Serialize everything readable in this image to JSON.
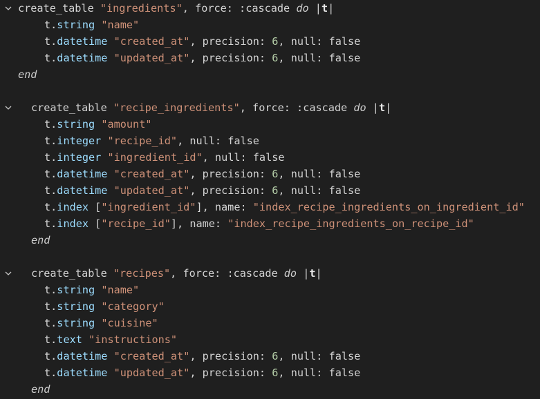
{
  "editor": {
    "colors": {
      "background": "#1f1f1f",
      "text": "#d4d4d4",
      "string": "#ce9178",
      "method": "#9cdcfe",
      "number": "#b5cea8"
    },
    "fold_icon": "chevron-down-icon",
    "lines": [
      {
        "fold": true,
        "indent": 0,
        "tokens": [
          [
            "plain",
            "create_table "
          ],
          [
            "str",
            "\"ingredients\""
          ],
          [
            "punct",
            ", "
          ],
          [
            "plain",
            "force: :cascade "
          ],
          [
            "kw-italic",
            "do"
          ],
          [
            "plain",
            " |"
          ],
          [
            "bold",
            "t"
          ],
          [
            "plain",
            "|"
          ]
        ]
      },
      {
        "fold": false,
        "indent": 2,
        "tokens": [
          [
            "plain",
            "t."
          ],
          [
            "method",
            "string"
          ],
          [
            "plain",
            " "
          ],
          [
            "str",
            "\"name\""
          ]
        ]
      },
      {
        "fold": false,
        "indent": 2,
        "tokens": [
          [
            "plain",
            "t."
          ],
          [
            "method",
            "datetime"
          ],
          [
            "plain",
            " "
          ],
          [
            "str",
            "\"created_at\""
          ],
          [
            "punct",
            ", "
          ],
          [
            "plain",
            "precision: "
          ],
          [
            "num",
            "6"
          ],
          [
            "punct",
            ", "
          ],
          [
            "plain",
            "null: false"
          ]
        ]
      },
      {
        "fold": false,
        "indent": 2,
        "tokens": [
          [
            "plain",
            "t."
          ],
          [
            "method",
            "datetime"
          ],
          [
            "plain",
            " "
          ],
          [
            "str",
            "\"updated_at\""
          ],
          [
            "punct",
            ", "
          ],
          [
            "plain",
            "precision: "
          ],
          [
            "num",
            "6"
          ],
          [
            "punct",
            ", "
          ],
          [
            "plain",
            "null: false"
          ]
        ]
      },
      {
        "fold": false,
        "indent": 0,
        "tokens": [
          [
            "kw-italic",
            "end"
          ]
        ]
      },
      {
        "fold": false,
        "indent": 0,
        "tokens": []
      },
      {
        "fold": true,
        "indent": 1,
        "tokens": [
          [
            "plain",
            "create_table "
          ],
          [
            "str",
            "\"recipe_ingredients\""
          ],
          [
            "punct",
            ", "
          ],
          [
            "plain",
            "force: :cascade "
          ],
          [
            "kw-italic",
            "do"
          ],
          [
            "plain",
            " |"
          ],
          [
            "bold",
            "t"
          ],
          [
            "plain",
            "|"
          ]
        ]
      },
      {
        "fold": false,
        "indent": 2,
        "tokens": [
          [
            "plain",
            "t."
          ],
          [
            "method",
            "string"
          ],
          [
            "plain",
            " "
          ],
          [
            "str",
            "\"amount\""
          ]
        ]
      },
      {
        "fold": false,
        "indent": 2,
        "tokens": [
          [
            "plain",
            "t."
          ],
          [
            "method",
            "integer"
          ],
          [
            "plain",
            " "
          ],
          [
            "str",
            "\"recipe_id\""
          ],
          [
            "punct",
            ", "
          ],
          [
            "plain",
            "null: false"
          ]
        ]
      },
      {
        "fold": false,
        "indent": 2,
        "tokens": [
          [
            "plain",
            "t."
          ],
          [
            "method",
            "integer"
          ],
          [
            "plain",
            " "
          ],
          [
            "str",
            "\"ingredient_id\""
          ],
          [
            "punct",
            ", "
          ],
          [
            "plain",
            "null: false"
          ]
        ]
      },
      {
        "fold": false,
        "indent": 2,
        "tokens": [
          [
            "plain",
            "t."
          ],
          [
            "method",
            "datetime"
          ],
          [
            "plain",
            " "
          ],
          [
            "str",
            "\"created_at\""
          ],
          [
            "punct",
            ", "
          ],
          [
            "plain",
            "precision: "
          ],
          [
            "num",
            "6"
          ],
          [
            "punct",
            ", "
          ],
          [
            "plain",
            "null: false"
          ]
        ]
      },
      {
        "fold": false,
        "indent": 2,
        "tokens": [
          [
            "plain",
            "t."
          ],
          [
            "method",
            "datetime"
          ],
          [
            "plain",
            " "
          ],
          [
            "str",
            "\"updated_at\""
          ],
          [
            "punct",
            ", "
          ],
          [
            "plain",
            "precision: "
          ],
          [
            "num",
            "6"
          ],
          [
            "punct",
            ", "
          ],
          [
            "plain",
            "null: false"
          ]
        ]
      },
      {
        "fold": false,
        "indent": 2,
        "tokens": [
          [
            "plain",
            "t."
          ],
          [
            "method",
            "index"
          ],
          [
            "plain",
            " ["
          ],
          [
            "str",
            "\"ingredient_id\""
          ],
          [
            "plain",
            "], name: "
          ],
          [
            "str",
            "\"index_recipe_ingredients_on_ingredient_id\""
          ]
        ]
      },
      {
        "fold": false,
        "indent": 2,
        "tokens": [
          [
            "plain",
            "t."
          ],
          [
            "method",
            "index"
          ],
          [
            "plain",
            " ["
          ],
          [
            "str",
            "\"recipe_id\""
          ],
          [
            "plain",
            "], name: "
          ],
          [
            "str",
            "\"index_recipe_ingredients_on_recipe_id\""
          ]
        ]
      },
      {
        "fold": false,
        "indent": 1,
        "tokens": [
          [
            "kw-italic",
            "end"
          ]
        ]
      },
      {
        "fold": false,
        "indent": 0,
        "tokens": []
      },
      {
        "fold": true,
        "indent": 1,
        "tokens": [
          [
            "plain",
            "create_table "
          ],
          [
            "str",
            "\"recipes\""
          ],
          [
            "punct",
            ", "
          ],
          [
            "plain",
            "force: :cascade "
          ],
          [
            "kw-italic",
            "do"
          ],
          [
            "plain",
            " |"
          ],
          [
            "bold",
            "t"
          ],
          [
            "plain",
            "|"
          ]
        ]
      },
      {
        "fold": false,
        "indent": 2,
        "tokens": [
          [
            "plain",
            "t."
          ],
          [
            "method",
            "string"
          ],
          [
            "plain",
            " "
          ],
          [
            "str",
            "\"name\""
          ]
        ]
      },
      {
        "fold": false,
        "indent": 2,
        "tokens": [
          [
            "plain",
            "t."
          ],
          [
            "method",
            "string"
          ],
          [
            "plain",
            " "
          ],
          [
            "str",
            "\"category\""
          ]
        ]
      },
      {
        "fold": false,
        "indent": 2,
        "tokens": [
          [
            "plain",
            "t."
          ],
          [
            "method",
            "string"
          ],
          [
            "plain",
            " "
          ],
          [
            "str",
            "\"cuisine\""
          ]
        ]
      },
      {
        "fold": false,
        "indent": 2,
        "tokens": [
          [
            "plain",
            "t."
          ],
          [
            "method",
            "text"
          ],
          [
            "plain",
            " "
          ],
          [
            "str",
            "\"instructions\""
          ]
        ]
      },
      {
        "fold": false,
        "indent": 2,
        "tokens": [
          [
            "plain",
            "t."
          ],
          [
            "method",
            "datetime"
          ],
          [
            "plain",
            " "
          ],
          [
            "str",
            "\"created_at\""
          ],
          [
            "punct",
            ", "
          ],
          [
            "plain",
            "precision: "
          ],
          [
            "num",
            "6"
          ],
          [
            "punct",
            ", "
          ],
          [
            "plain",
            "null: false"
          ]
        ]
      },
      {
        "fold": false,
        "indent": 2,
        "tokens": [
          [
            "plain",
            "t."
          ],
          [
            "method",
            "datetime"
          ],
          [
            "plain",
            " "
          ],
          [
            "str",
            "\"updated_at\""
          ],
          [
            "punct",
            ", "
          ],
          [
            "plain",
            "precision: "
          ],
          [
            "num",
            "6"
          ],
          [
            "punct",
            ", "
          ],
          [
            "plain",
            "null: false"
          ]
        ]
      },
      {
        "fold": false,
        "indent": 1,
        "tokens": [
          [
            "kw-italic",
            "end"
          ]
        ]
      }
    ]
  }
}
